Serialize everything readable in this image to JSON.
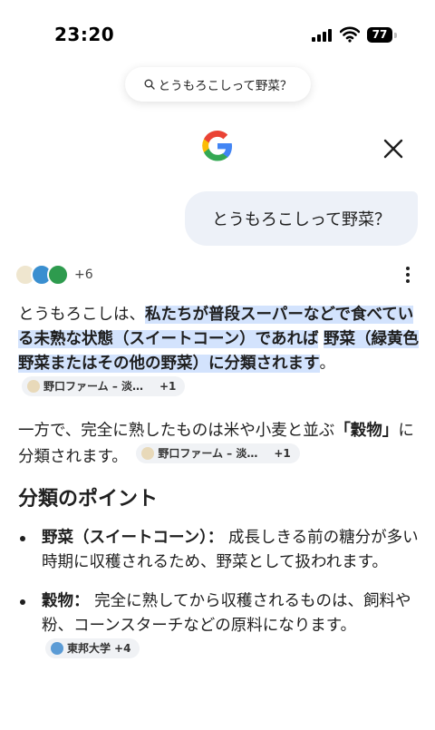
{
  "status_bar": {
    "time": "23:20",
    "battery": "77"
  },
  "search_pill": {
    "query": "とうもろこしって野菜？"
  },
  "user_message": "とうもろこしって野菜？",
  "sources": {
    "more": "+6"
  },
  "answer": {
    "p1": {
      "t1": "とうもろこしは、",
      "hl1": "私たちが普段スーパーなどで食べている未熟な状態（スイートコーン）であれば",
      "t2": " ",
      "hl2": "野菜（緑黄色野菜またはその他の野菜）に分類されます",
      "t3": "。",
      "chip_label": "野口ファーム – 淡…",
      "chip_more": "+1"
    },
    "p2": {
      "t1": "一方で、完全に熟したものは米や小麦と並ぶ",
      "b1": "「穀物」",
      "t2": "に分類されます。",
      "chip_label": "野口ファーム – 淡…",
      "chip_more": "+1"
    },
    "heading": "分類のポイント",
    "bullets": [
      {
        "term": "野菜（スイートコーン）：",
        "text": " 成長しきる前の糖分が多い時期に収穫されるため、野菜として扱われます。"
      },
      {
        "term": "穀物：",
        "text": " 完全に熟してから収穫されるものは、飼料や粉、コーンスターチなどの原料になります。",
        "chip_label": "東邦大学",
        "chip_more": "+4"
      }
    ]
  }
}
